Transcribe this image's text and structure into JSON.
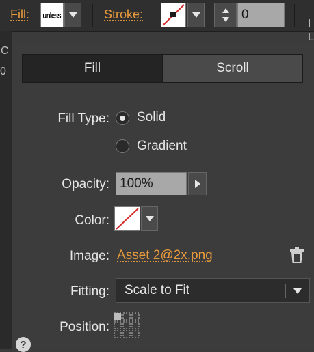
{
  "toolbar": {
    "fill_label": "Fill:",
    "fill_swatch_text": "unless",
    "stroke_label": "Stroke:",
    "stroke_width_value": "0",
    "right_edge_glyph_top": "I",
    "right_edge_glyph_bottom": "L"
  },
  "tabs": [
    {
      "label": "Fill",
      "active": true
    },
    {
      "label": "Scroll",
      "active": false
    }
  ],
  "fill_type": {
    "label": "Fill Type:",
    "options": [
      "Solid",
      "Gradient"
    ],
    "selected": "Solid"
  },
  "opacity": {
    "label": "Opacity:",
    "value": "100%"
  },
  "color": {
    "label": "Color:"
  },
  "image": {
    "label": "Image:",
    "filename": "Asset 2@2x.png"
  },
  "fitting": {
    "label": "Fitting:",
    "value": "Scale to Fit"
  },
  "position": {
    "label": "Position:"
  },
  "help": {
    "glyph": "?"
  },
  "left_edge": {
    "glyph_top": "C",
    "glyph_bottom": "0"
  },
  "colors": {
    "accent": "#e89a3c",
    "none_slash": "#d42b2b",
    "panel": "#3c3c3c"
  }
}
